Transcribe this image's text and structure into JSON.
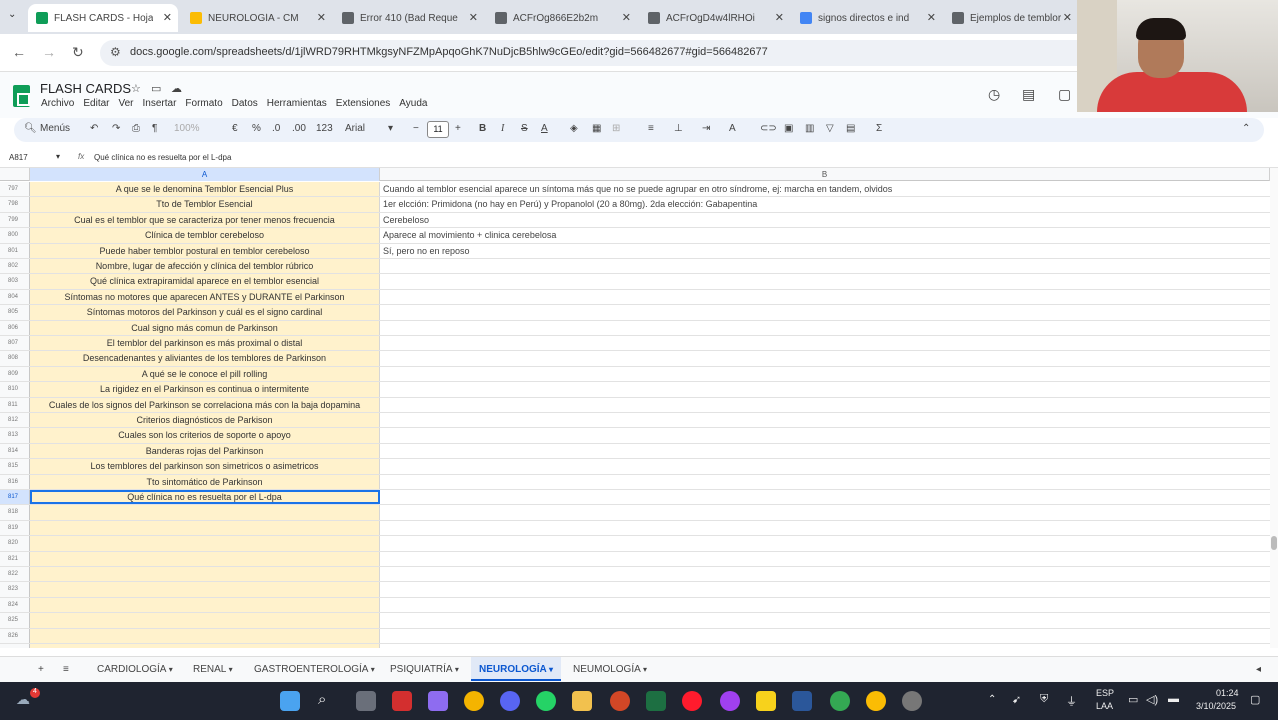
{
  "browser": {
    "tabs": [
      {
        "title": "FLASH CARDS - Hoja",
        "favicon_color": "#0f9d58",
        "active": true
      },
      {
        "title": "NEUROLOGÍA - CM",
        "favicon_color": "#fbbc04",
        "active": false
      },
      {
        "title": "Error 410 (Bad Reque",
        "favicon_color": "#5f6368",
        "active": false
      },
      {
        "title": "ACFrOg866E2b2m",
        "favicon_color": "#5f6368",
        "active": false
      },
      {
        "title": "ACFrOgD4w4lRHOi",
        "favicon_color": "#5f6368",
        "active": false
      },
      {
        "title": "signos directos e ind",
        "favicon_color": "#4285f4",
        "active": false
      },
      {
        "title": "Ejemplos de temblor",
        "favicon_color": "#5f6368",
        "active": false
      }
    ],
    "url": "docs.google.com/spreadsheets/d/1jlWRD79RHTMkgsyNFZMpApqoGhK7NuDjcB5hlw9cGEo/edit?gid=566482677#gid=566482677"
  },
  "sheets": {
    "title": "FLASH CARDS",
    "menu": [
      "Archivo",
      "Editar",
      "Ver",
      "Insertar",
      "Formato",
      "Datos",
      "Herramientas",
      "Extensiones",
      "Ayuda"
    ],
    "toolbar": {
      "menus_label": "Menús",
      "zoom": "100%",
      "currency": "€",
      "percent": "%",
      "decimals_less": ".0",
      "decimals_more": ".00",
      "number_format": "123",
      "font": "Arial",
      "font_size": "11"
    },
    "name_box": "A817",
    "formula": "Qué clínica no es resuelta por el L-dpa",
    "columns": [
      "A",
      "B"
    ],
    "rows": [
      {
        "n": "797",
        "a": "A que se le denomina Temblor Esencial Plus",
        "b": "Cuando al temblor esencial aparece un síntoma más que no se puede agrupar en otro síndrome, ej: marcha en tandem, olvidos"
      },
      {
        "n": "798",
        "a": "Tto de Temblor Esencial",
        "b": "1er elcción: Primidona (no hay en Perú) y Propanolol (20 a 80mg). 2da elección: Gabapentina"
      },
      {
        "n": "799",
        "a": "Cual es el temblor que se caracteriza por tener menos frecuencia",
        "b": "Cerebeloso"
      },
      {
        "n": "800",
        "a": "Clínica de temblor cerebeloso",
        "b": "Aparece al movimiento +  clinica cerebelosa"
      },
      {
        "n": "801",
        "a": "Puede haber temblor postural en temblor cerebeloso",
        "b": "Sí, pero no en reposo"
      },
      {
        "n": "802",
        "a": "Nombre, lugar de afección y clínica del temblor rúbrico",
        "b": ""
      },
      {
        "n": "803",
        "a": "Qué clínica extrapiramidal aparece en el temblor esencial",
        "b": ""
      },
      {
        "n": "804",
        "a": "Síntomas no motores que aparecen ANTES y  DURANTE el Parkinson",
        "b": ""
      },
      {
        "n": "805",
        "a": "Síntomas motoros del Parkinson y cuál es el signo cardinal",
        "b": ""
      },
      {
        "n": "806",
        "a": "Cual signo más comun de Parkinson",
        "b": ""
      },
      {
        "n": "807",
        "a": "El temblor del parkinson es más proximal o distal",
        "b": ""
      },
      {
        "n": "808",
        "a": "Desencadenantes y aliviantes de los temblores de Parkinson",
        "b": ""
      },
      {
        "n": "809",
        "a": "A qué se le conoce el pill rolling",
        "b": ""
      },
      {
        "n": "810",
        "a": "La rigidez en el Parkinson es continua o intermitente",
        "b": ""
      },
      {
        "n": "811",
        "a": "Cuales de los signos del Parkinson se correlaciona más con la baja dopamina",
        "b": ""
      },
      {
        "n": "812",
        "a": "Criterios diagnósticos de Parkison",
        "b": ""
      },
      {
        "n": "813",
        "a": "Cuales son los criterios de soporte o apoyo",
        "b": ""
      },
      {
        "n": "814",
        "a": "Banderas rojas del Parkinson",
        "b": ""
      },
      {
        "n": "815",
        "a": "Los temblores del parkinson son simetricos o asimetricos",
        "b": ""
      },
      {
        "n": "816",
        "a": "Tto sintomático de Parkinson",
        "b": ""
      },
      {
        "n": "817",
        "a": "Qué clínica no es resuelta por el L-dpa",
        "b": "",
        "selected": true
      },
      {
        "n": "818",
        "a": "",
        "b": ""
      },
      {
        "n": "819",
        "a": "",
        "b": ""
      },
      {
        "n": "820",
        "a": "",
        "b": ""
      },
      {
        "n": "821",
        "a": "",
        "b": ""
      },
      {
        "n": "822",
        "a": "",
        "b": ""
      },
      {
        "n": "823",
        "a": "",
        "b": ""
      },
      {
        "n": "824",
        "a": "",
        "b": ""
      },
      {
        "n": "825",
        "a": "",
        "b": ""
      },
      {
        "n": "826",
        "a": "",
        "b": ""
      },
      {
        "n": "827",
        "a": "",
        "b": ""
      }
    ],
    "sheet_tabs": [
      {
        "label": "CARDIOLOGÍA",
        "active": false
      },
      {
        "label": "RENAL",
        "active": false
      },
      {
        "label": "GASTROENTEROLOGÍA",
        "active": false
      },
      {
        "label": "PSIQUIATRÍA",
        "active": false
      },
      {
        "label": "NEUROLOGÍA",
        "active": true
      },
      {
        "label": "NEUMOLOGÍA",
        "active": false
      }
    ]
  },
  "taskbar": {
    "notification_badge": "4",
    "language": "ESP",
    "layout": "LAA",
    "time": "01:24",
    "date": "3/10/2025"
  },
  "colors": {
    "question_cell_bg": "#fff2cc",
    "selection": "#1a73e8",
    "active_tab": "#0b57d0"
  }
}
